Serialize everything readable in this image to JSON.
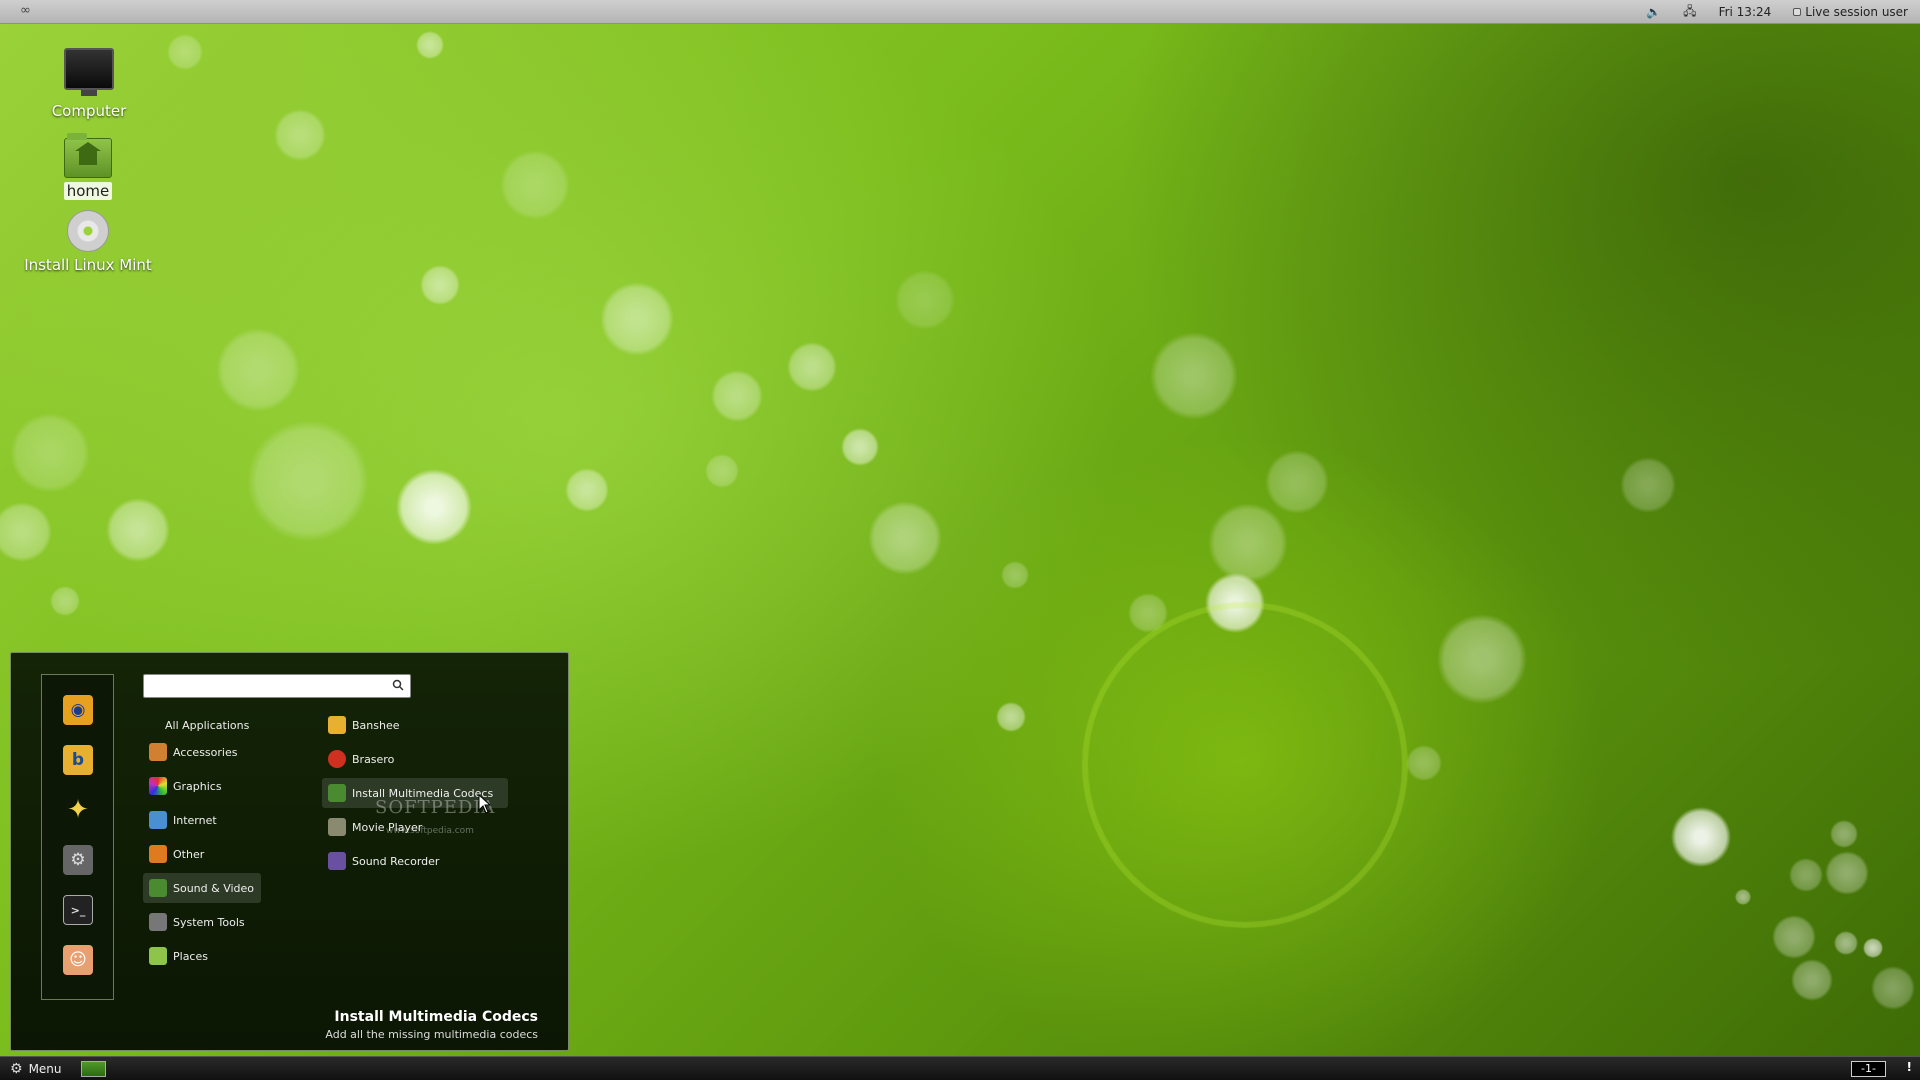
{
  "top_panel": {
    "left_icon": "mint-logo-icon",
    "clock": "Fri 13:24",
    "session_label": "Live session user",
    "volume_icon": "volume-icon",
    "network_icon": "network-icon"
  },
  "desktop": {
    "icons": [
      {
        "label": "Computer",
        "icon": "computer-icon"
      },
      {
        "label": "home",
        "icon": "home-folder-icon"
      },
      {
        "label": "Install Linux Mint",
        "icon": "install-disc-icon"
      }
    ]
  },
  "menu": {
    "search": {
      "value": "",
      "placeholder": ""
    },
    "favorites": [
      {
        "icon": "web-browser-icon",
        "color": "#e8a020"
      },
      {
        "icon": "banshee-icon",
        "color": "#e8b030"
      },
      {
        "icon": "star-icon",
        "color": "#f2d24a"
      },
      {
        "icon": "system-settings-icon",
        "color": "#666666"
      },
      {
        "icon": "terminal-icon",
        "color": "#222222"
      },
      {
        "icon": "user-icon",
        "color": "#e8a070"
      }
    ],
    "categories": [
      {
        "label": "All Applications",
        "icon": ""
      },
      {
        "label": "Accessories",
        "icon": "accessories-icon",
        "color": "#d08030"
      },
      {
        "label": "Graphics",
        "icon": "graphics-icon",
        "color": "#c040c0"
      },
      {
        "label": "Internet",
        "icon": "internet-icon",
        "color": "#4a90d0"
      },
      {
        "label": "Other",
        "icon": "other-icon",
        "color": "#e07a20"
      },
      {
        "label": "Sound & Video",
        "icon": "sound-video-icon",
        "color": "#4a8a30"
      },
      {
        "label": "System Tools",
        "icon": "system-tools-icon",
        "color": "#777777"
      },
      {
        "label": "Places",
        "icon": "places-folder-icon",
        "color": "#8fc44a"
      }
    ],
    "selected_category": "Sound & Video",
    "apps": [
      {
        "label": "Banshee",
        "icon": "banshee-icon",
        "color": "#e8b030"
      },
      {
        "label": "Brasero",
        "icon": "brasero-icon",
        "color": "#d03020"
      },
      {
        "label": "Install Multimedia Codecs",
        "icon": "codecs-icon",
        "color": "#4a8a30"
      },
      {
        "label": "Movie Player",
        "icon": "movie-player-icon",
        "color": "#8a8a70"
      },
      {
        "label": "Sound Recorder",
        "icon": "sound-recorder-icon",
        "color": "#6a50a0"
      }
    ],
    "selected_app": "Install Multimedia Codecs",
    "description": {
      "title": "Install Multimedia Codecs",
      "subtitle": "Add all the missing multimedia codecs"
    },
    "watermark": "SOFTPEDIA",
    "watermark_url": "www.softpedia.com"
  },
  "bottom_panel": {
    "menu_label": "Menu",
    "workspace_label": "-1-",
    "notification_label": "!"
  },
  "colors": {
    "panel_top": "#c4c4c4",
    "menu_bg": "#0f1d05",
    "desktop_green": "#7bbd1c"
  }
}
